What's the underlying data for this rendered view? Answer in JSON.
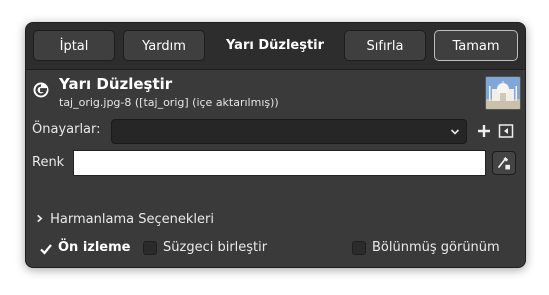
{
  "header": {
    "cancel_label": "İptal",
    "help_label": "Yardım",
    "title": "Yarı Düzleştir",
    "reset_label": "Sıfırla",
    "ok_label": "Tamam"
  },
  "filter": {
    "title": "Yarı Düzleştir",
    "subtitle": "taj_orig.jpg-8 ([taj_orig] (içe aktarılmış))"
  },
  "presets": {
    "label": "Önayarlar:",
    "value": ""
  },
  "color": {
    "label": "Renk",
    "value_color": "#ffffff"
  },
  "blending": {
    "label": "Harmanlama Seçenekleri"
  },
  "options": {
    "preview_label": "Ön izleme",
    "preview_checked": true,
    "merge_label": "Süzgeci birleştir",
    "merge_checked": false,
    "split_label": "Bölünmüş görünüm",
    "split_checked": false
  },
  "icons": {
    "logo": "gimp-icon",
    "add": "plus-icon",
    "manage": "menu-icon",
    "picker": "color-picker-icon",
    "combo": "chevron-down-icon",
    "expander": "chevron-right-icon",
    "check": "checkmark-icon"
  }
}
